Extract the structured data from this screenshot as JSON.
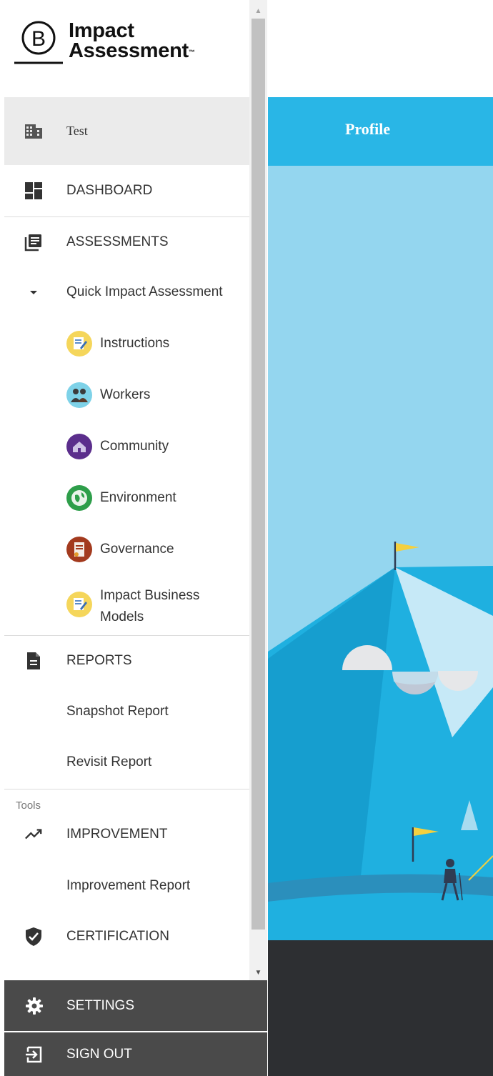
{
  "brand": {
    "letter": "B",
    "line1": "Impact",
    "line2": "Assessment",
    "tm": "™"
  },
  "company": {
    "name": "Test",
    "icon": "building-icon"
  },
  "nav": {
    "dashboard": {
      "label": "DASHBOARD",
      "icon": "dashboard-icon"
    },
    "assessments": {
      "label": "ASSESSMENTS",
      "icon": "assessments-icon"
    },
    "quick_impact": {
      "label": "Quick Impact Assessment",
      "icon": "caret-down-icon"
    },
    "topics": [
      {
        "label": "Instructions",
        "icon": "instructions-icon",
        "color": "#f5d65b"
      },
      {
        "label": "Workers",
        "icon": "workers-icon",
        "color": "#7ed2e8"
      },
      {
        "label": "Community",
        "icon": "community-icon",
        "color": "#5b2e8c"
      },
      {
        "label": "Environment",
        "icon": "environment-icon",
        "color": "#2e9e4a"
      },
      {
        "label": "Governance",
        "icon": "governance-icon",
        "color": "#a33a1e"
      },
      {
        "label_line1": "Impact Business",
        "label_line2": "Models",
        "icon": "instructions-icon",
        "color": "#f5d65b"
      }
    ],
    "reports": {
      "label": "REPORTS",
      "icon": "report-icon"
    },
    "snapshot_report": "Snapshot Report",
    "revisit_report": "Revisit Report",
    "tools_heading": "Tools",
    "improvement": {
      "label": "IMPROVEMENT",
      "icon": "trending-up-icon"
    },
    "improvement_report": "Improvement Report",
    "certification": {
      "label": "CERTIFICATION",
      "icon": "shield-check-icon"
    }
  },
  "bottom": {
    "settings": {
      "label": "SETTINGS",
      "icon": "gear-icon"
    },
    "signout": {
      "label": "SIGN OUT",
      "icon": "sign-out-icon"
    }
  },
  "main": {
    "tab_title": "Profile"
  },
  "colors": {
    "accent": "#29b6e6",
    "sidebar_active": "#ebebeb",
    "dark_footer": "#2d2f32",
    "bottom_button": "#4a4a4a"
  }
}
